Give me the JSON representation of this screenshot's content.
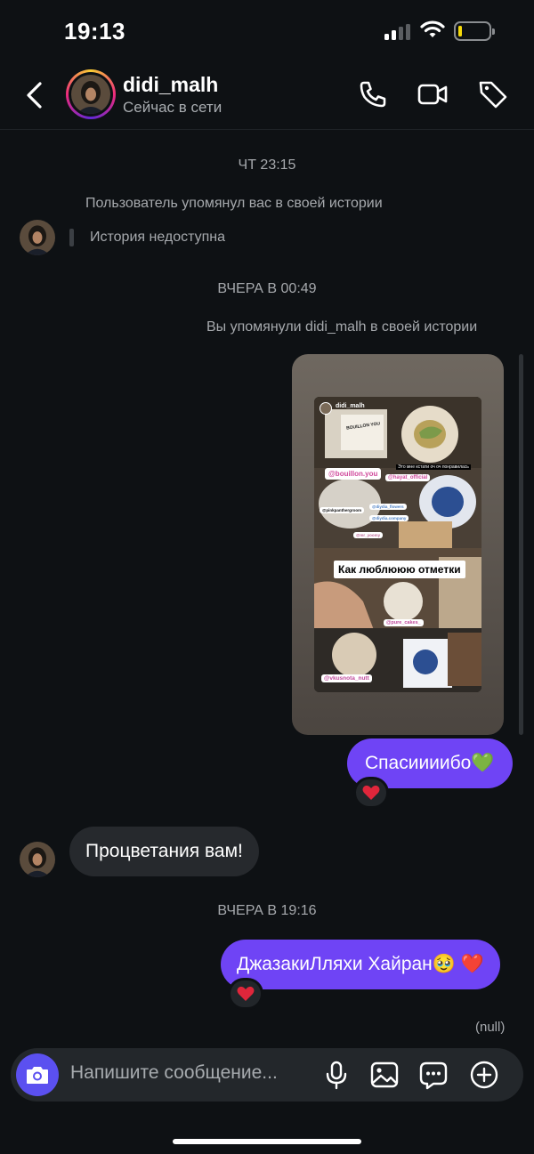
{
  "status_bar": {
    "time": "19:13"
  },
  "header": {
    "username": "didi_malh",
    "status": "Сейчас в сети"
  },
  "chat": {
    "ts1": "ЧТ 23:15",
    "mention_note": "Пользователь упомянул вас в своей истории",
    "story_unavailable": "История недоступна",
    "ts2": "ВЧЕРА В 00:49",
    "you_mentioned": "Вы упомянули didi_malh в своей истории",
    "story": {
      "username": "didi_malh",
      "caption": "Как люблююю отметки",
      "small_text": "Это мне кстати оч оч понравилась",
      "tags": [
        "@bouillon.you",
        "@hayat_official",
        "@pinkpanthergroom",
        "@diydia_flowers",
        "@diydia.company",
        "@mr_yoomy",
        "@pure_cakes_",
        "@vkusnota_nutt"
      ],
      "box_label": "BOUILLON YOU"
    },
    "msg_out1": "Спасиииибо💚",
    "msg_in1": "Процветания вам!",
    "ts3": "ВЧЕРА В 19:16",
    "msg_out2": "ДжазакиЛляхи Хайран🥹 ❤️",
    "reaction": "❤️",
    "null_label": "(null)"
  },
  "composer": {
    "placeholder": "Напишите сообщение..."
  },
  "colors": {
    "accent": "#6f44f5",
    "camera": "#5b50f0",
    "background": "#0e1114",
    "incoming_bubble": "#26292d"
  }
}
